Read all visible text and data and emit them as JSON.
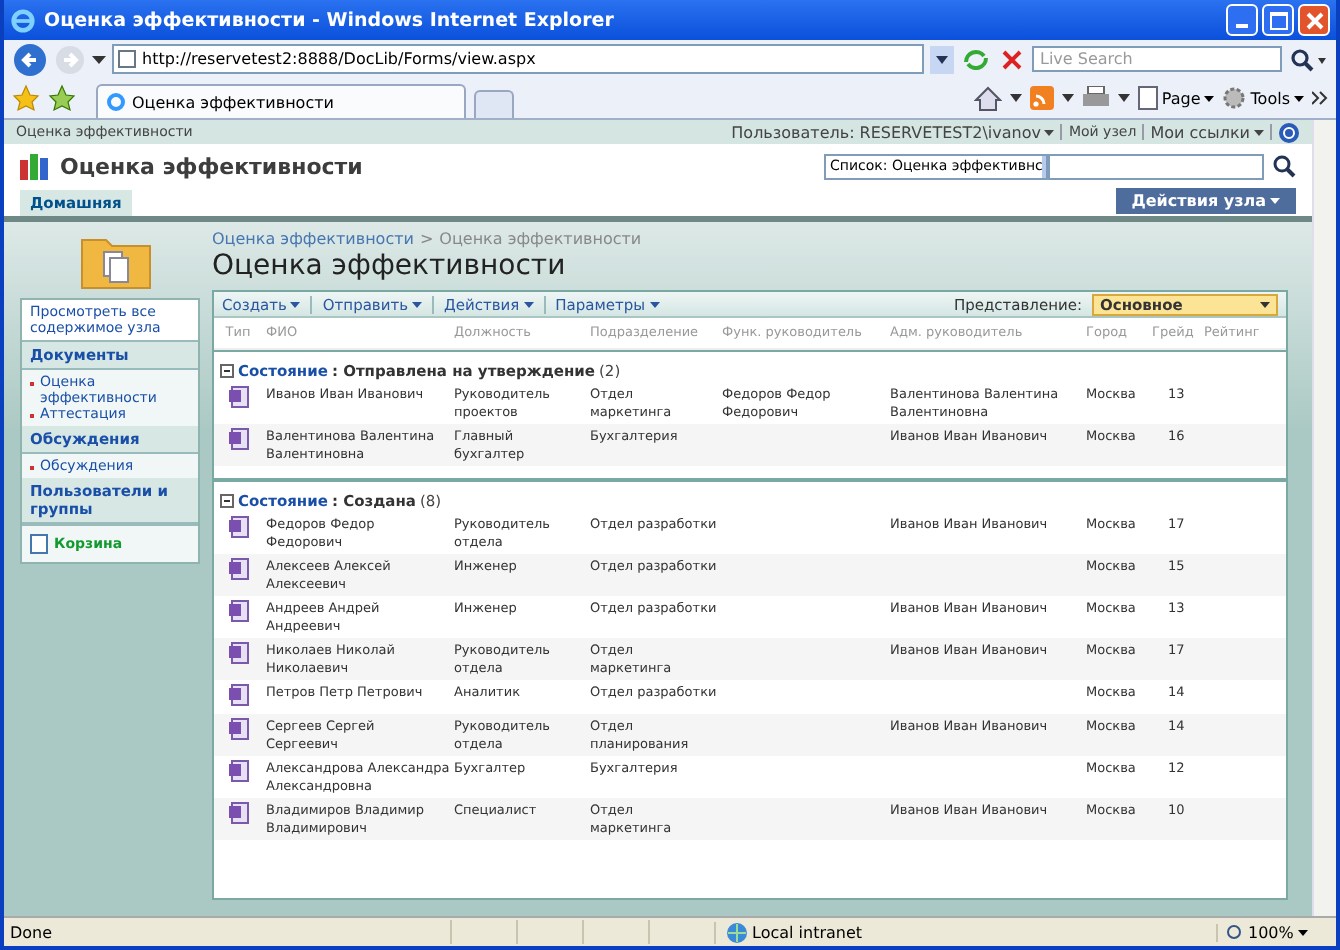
{
  "browser": {
    "title": "Оценка эффективности - Windows Internet Explorer",
    "address": "http://reservetest2:8888/DocLib/Forms/view.aspx",
    "search_placeholder": "Live Search",
    "tab_title": "Оценка эффективности",
    "page_menu": "Page",
    "tools_menu": "Tools"
  },
  "top_bar": {
    "site_link": "Оценка эффективности",
    "user": "Пользователь: RESERVETEST2\\ivanov",
    "my_site": "Мой узел",
    "my_links": "Мои ссылки"
  },
  "header": {
    "site_title": "Оценка эффективности",
    "search_scope": "Список: Оценка эффективнс",
    "tabs": [
      {
        "label": "Домашняя",
        "selected": true
      }
    ],
    "site_actions": "Действия узла"
  },
  "breadcrumb": [
    "Оценка эффективности",
    "Оценка эффективности"
  ],
  "breadcrumb_separator": ">",
  "page_title": "Оценка эффективности",
  "sidebar": {
    "view_all": "Просмотреть все содержимое узла",
    "sections": [
      {
        "title": "Документы",
        "items": [
          "Оценка эффективности",
          "Аттестация"
        ]
      },
      {
        "title": "Обсуждения",
        "items": [
          "Обсуждения"
        ]
      },
      {
        "title": "Пользователи и группы"
      }
    ],
    "recycle": "Корзина"
  },
  "toolbar": {
    "menus": [
      "Создать",
      "Отправить",
      "Действия",
      "Параметры"
    ],
    "view_label": "Представление:",
    "view_value": "Основное"
  },
  "table": {
    "columns": [
      "Тип",
      "ФИО",
      "Должность",
      "Подразделение",
      "Функ. руководитель",
      "Адм. руководитель",
      "Город",
      "Грейд",
      "Рейтинг"
    ],
    "groups": [
      {
        "field": "Состояние",
        "value": ": Отправлена на утверждение",
        "count": "(2)",
        "expanded": true,
        "rows": [
          {
            "name": "Иванов Иван Иванович",
            "position": "Руководитель проектов",
            "department": "Отдел маркетинга",
            "func_manager": "Федоров Федор Федорович",
            "adm_manager": "Валентинова Валентина Валентиновна",
            "city": "Москва",
            "grade": "13"
          },
          {
            "name": "Валентинова Валентина Валентиновна",
            "position": "Главный бухгалтер",
            "department": "Бухгалтерия",
            "adm_manager": "Иванов Иван Иванович",
            "city": "Москва",
            "grade": "16"
          }
        ]
      },
      {
        "field": "Состояние",
        "value": ": Создана",
        "count": "(8)",
        "expanded": true,
        "rows": [
          {
            "name": "Федоров Федор Федорович",
            "position": "Руководитель отдела",
            "department": "Отдел разработки",
            "adm_manager": "Иванов Иван Иванович",
            "city": "Москва",
            "grade": "17"
          },
          {
            "name": "Алексеев Алексей Алексеевич",
            "position": "Инженер",
            "department": "Отдел разработки",
            "city": "Москва",
            "grade": "15"
          },
          {
            "name": "Андреев Андрей Андреевич",
            "position": "Инженер",
            "department": "Отдел разработки",
            "adm_manager": "Иванов Иван Иванович",
            "city": "Москва",
            "grade": "13"
          },
          {
            "name": "Николаев Николай Николаевич",
            "position": "Руководитель отдела",
            "department": "Отдел маркетинга",
            "adm_manager": "Иванов Иван Иванович",
            "city": "Москва",
            "grade": "17"
          },
          {
            "name": "Петров Петр Петрович",
            "position": "Аналитик",
            "department": "Отдел разработки",
            "city": "Москва",
            "grade": "14"
          },
          {
            "name": "Сергеев Сергей Сергеевич",
            "position": "Руководитель отдела",
            "department": "Отдел планирования",
            "adm_manager": "Иванов Иван Иванович",
            "city": "Москва",
            "grade": "14"
          },
          {
            "name": "Александрова Александра Александровна",
            "position": "Бухгалтер",
            "department": "Бухгалтерия",
            "city": "Москва",
            "grade": "12"
          },
          {
            "name": "Владимиров Владимир Владимирович",
            "position": "Специалист",
            "department": "Отдел маркетинга",
            "adm_manager": "Иванов Иван Иванович",
            "city": "Москва",
            "grade": "10"
          }
        ]
      }
    ]
  },
  "status": {
    "text": "Done",
    "zone": "Local intranet",
    "zoom": "100%"
  }
}
